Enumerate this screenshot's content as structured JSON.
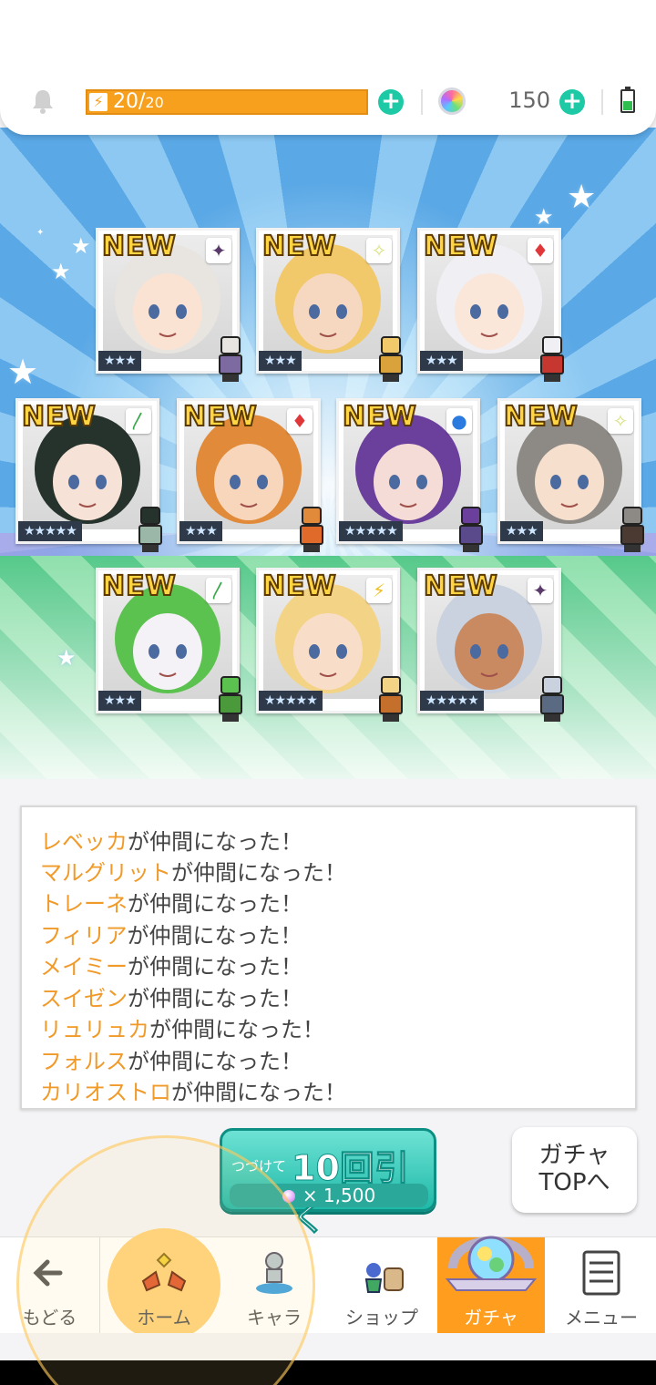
{
  "header": {
    "stamina_current": "20",
    "stamina_max": "20",
    "stamina_fraction": 1.0,
    "gem_count": "150"
  },
  "cards": [
    {
      "new": "NEW",
      "element": "dark",
      "rarity": "★★★",
      "hair": "#e8e4e0",
      "skin": "#fbe3d4",
      "sprite": "#7c6aa0"
    },
    {
      "new": "NEW",
      "element": "light",
      "rarity": "★★★",
      "hair": "#f1c96a",
      "skin": "#f6d8c0",
      "sprite": "#d9a23a"
    },
    {
      "new": "NEW",
      "element": "fire",
      "rarity": "★★★",
      "hair": "#f0f0f4",
      "skin": "#fbe6da",
      "sprite": "#c6382f"
    },
    {
      "new": "NEW",
      "element": "wind",
      "rarity": "★★★★★",
      "hair": "#26332c",
      "skin": "#f6e2d6",
      "sprite": "#9bb7a8"
    },
    {
      "new": "NEW",
      "element": "fire",
      "rarity": "★★★",
      "hair": "#e08a3a",
      "skin": "#f8d6bc",
      "sprite": "#e06a2a"
    },
    {
      "new": "NEW",
      "element": "water",
      "rarity": "★★★★★",
      "hair": "#6b3f9c",
      "skin": "#f6dcd6",
      "sprite": "#5a4a8c"
    },
    {
      "new": "NEW",
      "element": "light",
      "rarity": "★★★",
      "hair": "#8d8a86",
      "skin": "#f6dfcc",
      "sprite": "#4a3a32"
    },
    {
      "new": "NEW",
      "element": "wind",
      "rarity": "★★★",
      "hair": "#5cc24f",
      "skin": "#f4f2f6",
      "sprite": "#4a9a3c"
    },
    {
      "new": "NEW",
      "element": "thunder",
      "rarity": "★★★★★",
      "hair": "#f3d487",
      "skin": "#f8dec8",
      "sprite": "#c4702c"
    },
    {
      "new": "NEW",
      "element": "dark",
      "rarity": "★★★★★",
      "hair": "#c9d2de",
      "skin": "#c98a62",
      "sprite": "#5a6a82"
    }
  ],
  "log": [
    {
      "name": "レベッカ",
      "suffix": "が仲間になった！"
    },
    {
      "name": "マルグリット",
      "suffix": "が仲間になった！"
    },
    {
      "name": "トレーネ",
      "suffix": "が仲間になった！"
    },
    {
      "name": "フィリア",
      "suffix": "が仲間になった！"
    },
    {
      "name": "メイミー",
      "suffix": "が仲間になった！"
    },
    {
      "name": "スイゼン",
      "suffix": "が仲間になった！"
    },
    {
      "name": "リュリュカ",
      "suffix": "が仲間になった！"
    },
    {
      "name": "フォルス",
      "suffix": "が仲間になった！"
    },
    {
      "name": "カリオストロ",
      "suffix": "が仲間になった！"
    }
  ],
  "pull_button": {
    "prefix": "つづけて",
    "label": "10回引く",
    "cost": "× 1,500"
  },
  "gacha_top": {
    "line1": "ガチャ",
    "line2": "TOPへ"
  },
  "nav": {
    "back": "もどる",
    "home": "ホーム",
    "chara": "キャラ",
    "shop": "ショップ",
    "gacha": "ガチャ",
    "menu": "メニュー"
  },
  "colors": {
    "stamina": "#f6a01e",
    "plus": "#1ec9a6",
    "name_highlight": "#f09a2a",
    "nav_active": "#ff9d1e",
    "pull_button": "#1fb9a8"
  },
  "element_icons": {
    "dark": "✦",
    "light": "✧",
    "fire": "♦",
    "wind": "〳",
    "water": "●",
    "thunder": "⚡"
  }
}
